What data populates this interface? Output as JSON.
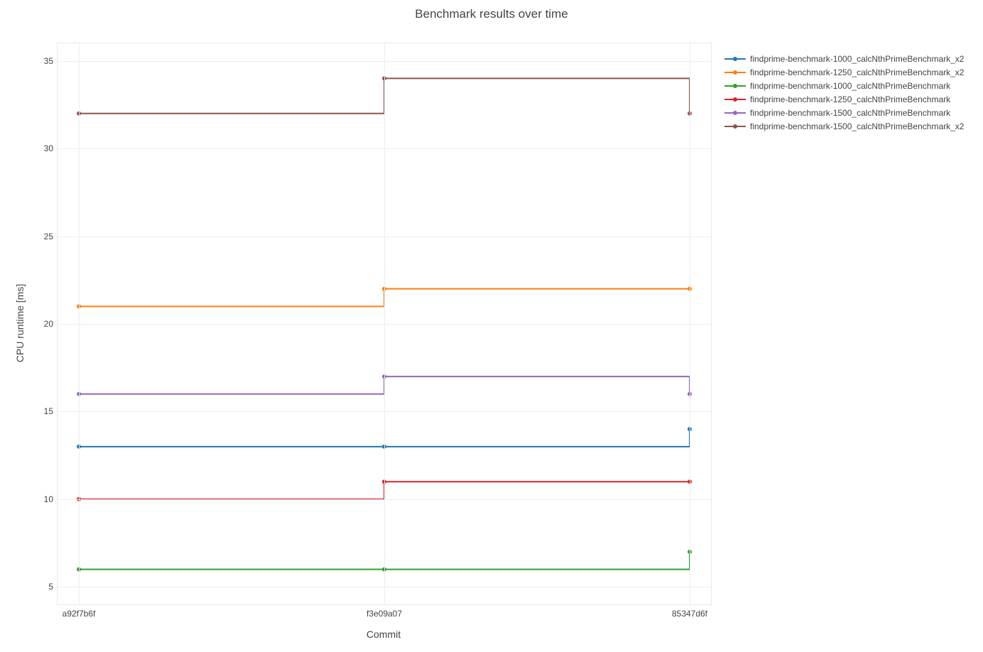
{
  "chart_data": {
    "type": "line",
    "title": "Benchmark results over time",
    "xlabel": "Commit",
    "ylabel": "CPU runtime [ms]",
    "ylim": [
      4,
      36
    ],
    "y_ticks": [
      5,
      10,
      15,
      20,
      25,
      30,
      35
    ],
    "categories": [
      "a92f7b6f",
      "f3e09a07",
      "85347d6f"
    ],
    "line_shape": "hv",
    "colors": {
      "blue": "#1f77b4",
      "orange": "#ff7f0e",
      "green": "#2ca02c",
      "red": "#d62728",
      "purple": "#9467bd",
      "brown": "#8c564b"
    },
    "series": [
      {
        "name": "findprime-benchmark-1000_calcNthPrimeBenchmark_x2",
        "color": "blue",
        "values": [
          13,
          13,
          14
        ]
      },
      {
        "name": "findprime-benchmark-1250_calcNthPrimeBenchmark_x2",
        "color": "orange",
        "values": [
          21,
          22,
          22
        ]
      },
      {
        "name": "findprime-benchmark-1000_calcNthPrimeBenchmark",
        "color": "green",
        "values": [
          6,
          6,
          7
        ]
      },
      {
        "name": "findprime-benchmark-1250_calcNthPrimeBenchmark",
        "color": "red",
        "values": [
          10,
          11,
          11
        ]
      },
      {
        "name": "findprime-benchmark-1500_calcNthPrimeBenchmark",
        "color": "purple",
        "values": [
          16,
          17,
          16
        ]
      },
      {
        "name": "findprime-benchmark-1500_calcNthPrimeBenchmark_x2",
        "color": "brown",
        "values": [
          32,
          34,
          32
        ]
      }
    ]
  }
}
